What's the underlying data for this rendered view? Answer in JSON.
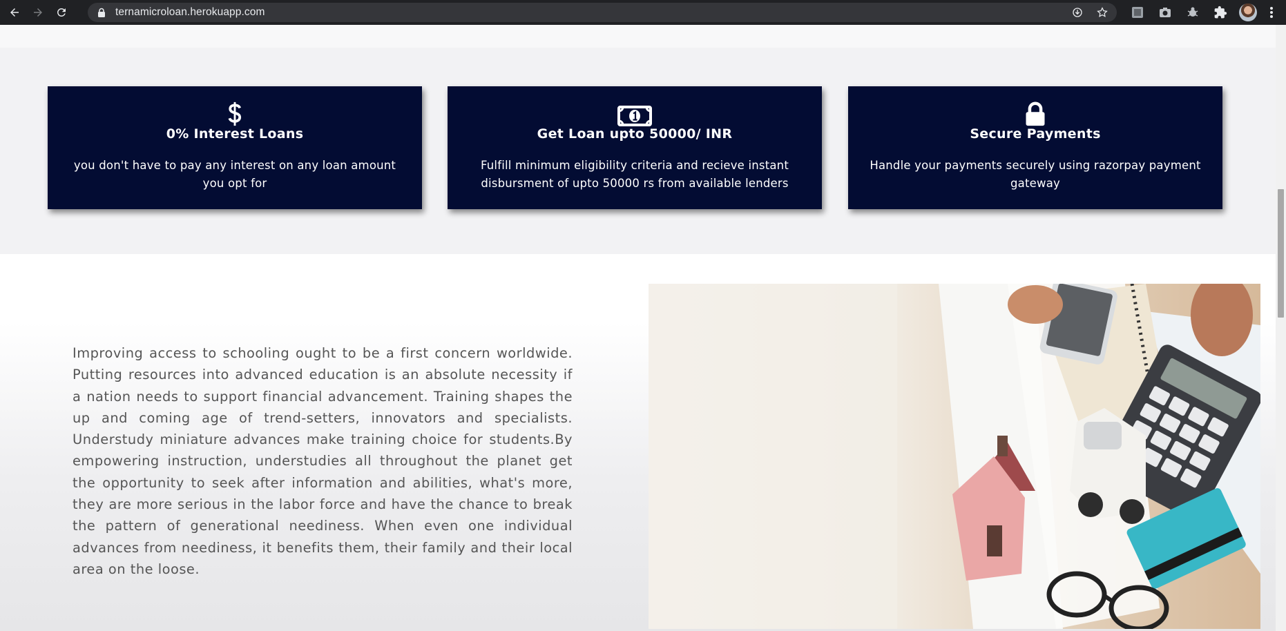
{
  "browser": {
    "url": "ternamicroloan.herokuapp.com",
    "icons": [
      "back-arrow-icon",
      "forward-arrow-icon",
      "reload-icon",
      "lock-icon",
      "install-app-icon",
      "bookmark-star-icon",
      "extension-icon",
      "camera-icon",
      "bug-icon",
      "puzzle-icon",
      "menu-dots-icon"
    ]
  },
  "features": [
    {
      "icon": "dollar-icon",
      "title": "0% Interest Loans",
      "description": "you don't have to pay any interest on any loan amount you opt for"
    },
    {
      "icon": "money-bill-icon",
      "title": "Get Loan upto 50000/ INR",
      "description": "Fulfill minimum eligibility criteria and recieve instant disbursment of upto 50000 rs from available lenders"
    },
    {
      "icon": "lock-icon",
      "title": "Secure Payments",
      "description": "Handle your payments securely using razorpay payment gateway"
    }
  ],
  "about": {
    "text": "Improving access to schooling ought to be a first concern worldwide. Putting resources into advanced education is an absolute necessity if a nation needs to support financial advancement. Training shapes the up and coming age of trend-setters, innovators and specialists. Understudy miniature advances make training choice for students.By empowering instruction, understudies all throughout the planet get the opportunity to seek after information and abilities, what's more, they are more serious in the labor force and have the chance to break the pattern of generational neediness. When even one individual advances from neediness, it benefits them, their family and their local area on the loose."
  },
  "colors": {
    "card_background": "#030c33",
    "card_text": "#ffffff",
    "body_text": "#555555",
    "section_background": "#f2f2f4"
  }
}
